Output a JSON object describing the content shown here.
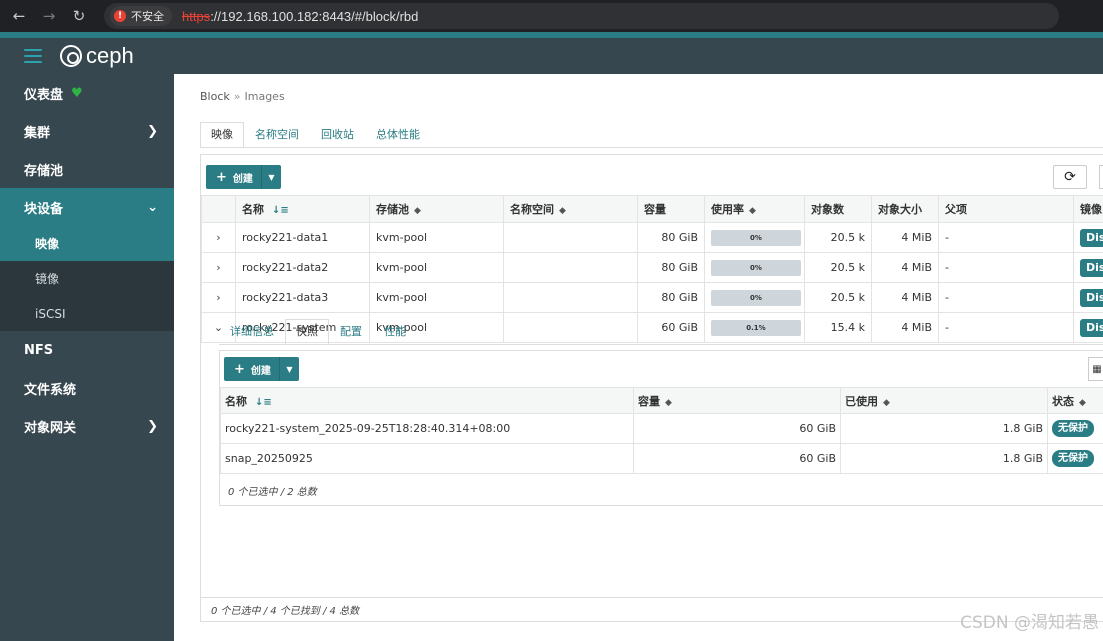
{
  "browser": {
    "insecure_label": "不安全",
    "url_scheme": "https",
    "url_rest": "://192.168.100.182:8443/#/block/rbd"
  },
  "brand": {
    "logo_text": "ceph"
  },
  "sidebar": {
    "items": [
      {
        "label": "仪表盘"
      },
      {
        "label": "集群"
      },
      {
        "label": "存储池"
      },
      {
        "label": "块设备"
      },
      {
        "label": "NFS"
      },
      {
        "label": "文件系统"
      },
      {
        "label": "对象网关"
      }
    ],
    "sub_items": [
      {
        "label": "映像"
      },
      {
        "label": "镜像"
      },
      {
        "label": "iSCSI"
      }
    ]
  },
  "breadcrumb": {
    "parent": "Block",
    "current": "Images"
  },
  "tabs": [
    "映像",
    "名称空间",
    "回收站",
    "总体性能"
  ],
  "toolbar": {
    "create_label": "创建"
  },
  "images_table": {
    "headers": [
      "名称",
      "存储池",
      "名称空间",
      "容量",
      "使用率",
      "对象数",
      "对象大小",
      "父项",
      "镜像"
    ],
    "rows": [
      {
        "name": "rocky221-data1",
        "pool": "kvm-pool",
        "namespace": "",
        "size": "80 GiB",
        "usage": "0%",
        "objects": "20.5 k",
        "object_size": "4 MiB",
        "parent": "-",
        "mirror": "Dis"
      },
      {
        "name": "rocky221-data2",
        "pool": "kvm-pool",
        "namespace": "",
        "size": "80 GiB",
        "usage": "0%",
        "objects": "20.5 k",
        "object_size": "4 MiB",
        "parent": "-",
        "mirror": "Dis"
      },
      {
        "name": "rocky221-data3",
        "pool": "kvm-pool",
        "namespace": "",
        "size": "80 GiB",
        "usage": "0%",
        "objects": "20.5 k",
        "object_size": "4 MiB",
        "parent": "-",
        "mirror": "Dis"
      },
      {
        "name": "rocky221-system",
        "pool": "kvm-pool",
        "namespace": "",
        "size": "60 GiB",
        "usage": "0.1%",
        "objects": "15.4 k",
        "object_size": "4 MiB",
        "parent": "-",
        "mirror": "Dis"
      }
    ],
    "footer": "0 个已选中 / 4 个已找到 / 4 总数"
  },
  "detail": {
    "tabs": [
      "详细信息",
      "快照",
      "配置",
      "性能"
    ],
    "create_label": "创建",
    "snap_headers": [
      "名称",
      "容量",
      "已使用",
      "状态"
    ],
    "snap_rows": [
      {
        "name": "rocky221-system_2025-09-25T18:28:40.314+08:00",
        "size": "60 GiB",
        "used": "1.8 GiB",
        "state": "无保护"
      },
      {
        "name": "snap_20250925",
        "size": "60 GiB",
        "used": "1.8 GiB",
        "state": "无保护"
      }
    ],
    "footer": "0 个已选中 / 2 总数"
  },
  "watermark": "CSDN @渴知若愚",
  "colors": {
    "accent": "#2a7d84",
    "sidebar": "#37474f",
    "sidebar_sub": "#2b373d"
  }
}
